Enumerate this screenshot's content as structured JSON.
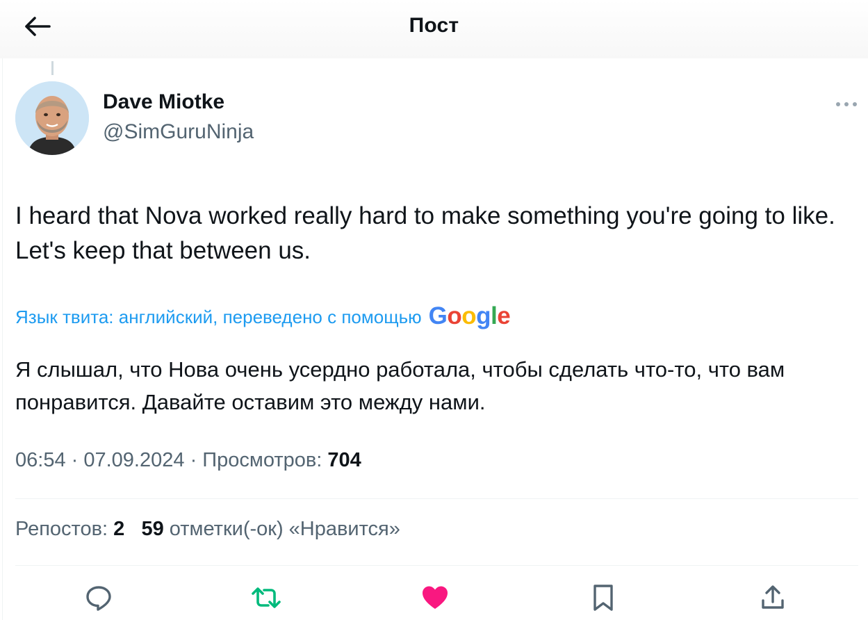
{
  "header": {
    "title": "Пост"
  },
  "author": {
    "name": "Dave Miotke",
    "handle": "@SimGuruNinja"
  },
  "tweet": {
    "text": "I heard that Nova worked really hard to make something you're going to like. Let's keep that between us.",
    "translation_note": "Язык твита: английский, переведено с помощью",
    "translation_provider": "Google",
    "translated_text": "Я слышал, что Нова очень усердно работала, чтобы сделать что-то, что вам понравится. Давайте оставим это между нами."
  },
  "meta": {
    "time": "06:54",
    "date": "07.09.2024",
    "views_label": "Просмотров:",
    "views": "704"
  },
  "stats": {
    "reposts_label": "Репостов:",
    "reposts": "2",
    "likes": "59",
    "likes_label": "отметки(-ок) «Нравится»"
  },
  "actions": [
    "reply-icon",
    "retweet-icon",
    "like-icon",
    "bookmark-icon",
    "share-icon"
  ],
  "colors": {
    "link": "#1d9bf0",
    "retweet": "#00ba7c",
    "like": "#f91880",
    "secondary": "#536471"
  }
}
